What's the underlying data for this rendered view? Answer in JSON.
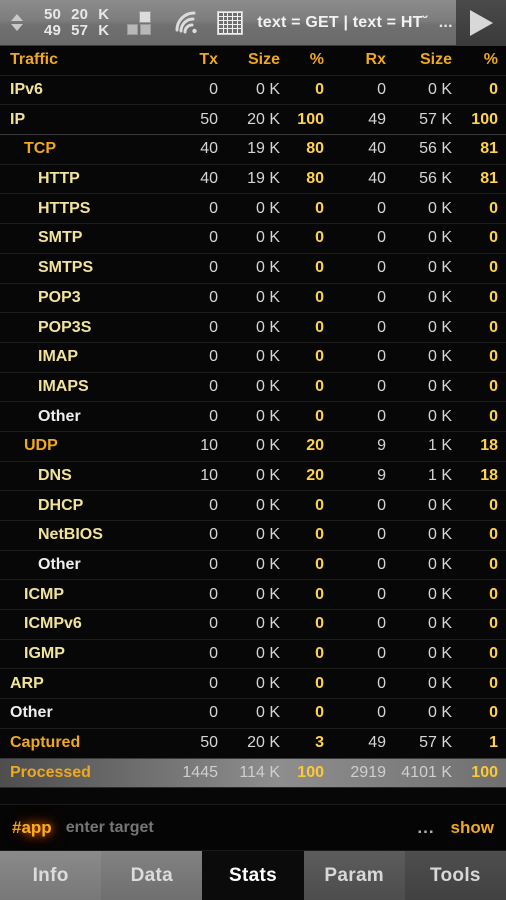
{
  "toolbar": {
    "counter_up": "50",
    "counter_down": "49",
    "size_up": "20",
    "size_down": "57",
    "unit_up": "K",
    "unit_down": "K",
    "icons": [
      "blocks-icon",
      "wifi-icon",
      "matrix-icon"
    ],
    "filter_text": "text = GET | text = HT˘",
    "filter_ellipsis": "...",
    "play_label": "play"
  },
  "table": {
    "columns": [
      "Traffic",
      "Tx",
      "Size",
      "%",
      "Rx",
      "Size",
      "%"
    ],
    "rows": [
      {
        "label": "IPv6",
        "indent": 0,
        "tone": "pale",
        "tx": "0",
        "tsize": "0 K",
        "tpct": "0",
        "rx": "0",
        "rsize": "0 K",
        "rpct": "0"
      },
      {
        "label": "IP",
        "indent": 0,
        "tone": "pale",
        "tx": "50",
        "tsize": "20 K",
        "tpct": "100",
        "rx": "49",
        "rsize": "57 K",
        "rpct": "100"
      },
      {
        "label": "TCP",
        "indent": 1,
        "tone": "amber",
        "tx": "40",
        "tsize": "19 K",
        "tpct": "80",
        "rx": "40",
        "rsize": "56 K",
        "rpct": "81"
      },
      {
        "label": "HTTP",
        "indent": 2,
        "tone": "pale",
        "tx": "40",
        "tsize": "19 K",
        "tpct": "80",
        "rx": "40",
        "rsize": "56 K",
        "rpct": "81"
      },
      {
        "label": "HTTPS",
        "indent": 2,
        "tone": "pale",
        "tx": "0",
        "tsize": "0 K",
        "tpct": "0",
        "rx": "0",
        "rsize": "0 K",
        "rpct": "0"
      },
      {
        "label": "SMTP",
        "indent": 2,
        "tone": "pale",
        "tx": "0",
        "tsize": "0 K",
        "tpct": "0",
        "rx": "0",
        "rsize": "0 K",
        "rpct": "0"
      },
      {
        "label": "SMTPS",
        "indent": 2,
        "tone": "pale",
        "tx": "0",
        "tsize": "0 K",
        "tpct": "0",
        "rx": "0",
        "rsize": "0 K",
        "rpct": "0"
      },
      {
        "label": "POP3",
        "indent": 2,
        "tone": "pale",
        "tx": "0",
        "tsize": "0 K",
        "tpct": "0",
        "rx": "0",
        "rsize": "0 K",
        "rpct": "0"
      },
      {
        "label": "POP3S",
        "indent": 2,
        "tone": "pale",
        "tx": "0",
        "tsize": "0 K",
        "tpct": "0",
        "rx": "0",
        "rsize": "0 K",
        "rpct": "0"
      },
      {
        "label": "IMAP",
        "indent": 2,
        "tone": "pale",
        "tx": "0",
        "tsize": "0 K",
        "tpct": "0",
        "rx": "0",
        "rsize": "0 K",
        "rpct": "0"
      },
      {
        "label": "IMAPS",
        "indent": 2,
        "tone": "pale",
        "tx": "0",
        "tsize": "0 K",
        "tpct": "0",
        "rx": "0",
        "rsize": "0 K",
        "rpct": "0"
      },
      {
        "label": "Other",
        "indent": 2,
        "tone": "white",
        "tx": "0",
        "tsize": "0 K",
        "tpct": "0",
        "rx": "0",
        "rsize": "0 K",
        "rpct": "0"
      },
      {
        "label": "UDP",
        "indent": 1,
        "tone": "amber",
        "tx": "10",
        "tsize": "0 K",
        "tpct": "20",
        "rx": "9",
        "rsize": "1 K",
        "rpct": "18"
      },
      {
        "label": "DNS",
        "indent": 2,
        "tone": "pale",
        "tx": "10",
        "tsize": "0 K",
        "tpct": "20",
        "rx": "9",
        "rsize": "1 K",
        "rpct": "18"
      },
      {
        "label": "DHCP",
        "indent": 2,
        "tone": "pale",
        "tx": "0",
        "tsize": "0 K",
        "tpct": "0",
        "rx": "0",
        "rsize": "0 K",
        "rpct": "0"
      },
      {
        "label": "NetBIOS",
        "indent": 2,
        "tone": "pale",
        "tx": "0",
        "tsize": "0 K",
        "tpct": "0",
        "rx": "0",
        "rsize": "0 K",
        "rpct": "0"
      },
      {
        "label": "Other",
        "indent": 2,
        "tone": "white",
        "tx": "0",
        "tsize": "0 K",
        "tpct": "0",
        "rx": "0",
        "rsize": "0 K",
        "rpct": "0"
      },
      {
        "label": "ICMP",
        "indent": 1,
        "tone": "pale",
        "tx": "0",
        "tsize": "0 K",
        "tpct": "0",
        "rx": "0",
        "rsize": "0 K",
        "rpct": "0"
      },
      {
        "label": "ICMPv6",
        "indent": 1,
        "tone": "pale",
        "tx": "0",
        "tsize": "0 K",
        "tpct": "0",
        "rx": "0",
        "rsize": "0 K",
        "rpct": "0"
      },
      {
        "label": "IGMP",
        "indent": 1,
        "tone": "pale",
        "tx": "0",
        "tsize": "0 K",
        "tpct": "0",
        "rx": "0",
        "rsize": "0 K",
        "rpct": "0"
      },
      {
        "label": "ARP",
        "indent": 0,
        "tone": "pale",
        "tx": "0",
        "tsize": "0 K",
        "tpct": "0",
        "rx": "0",
        "rsize": "0 K",
        "rpct": "0"
      },
      {
        "label": "Other",
        "indent": 0,
        "tone": "white",
        "tx": "0",
        "tsize": "0 K",
        "tpct": "0",
        "rx": "0",
        "rsize": "0 K",
        "rpct": "0"
      },
      {
        "label": "Captured",
        "indent": 0,
        "tone": "amber",
        "tx": "50",
        "tsize": "20 K",
        "tpct": "3",
        "rx": "49",
        "rsize": "57 K",
        "rpct": "1"
      },
      {
        "label": "Processed",
        "indent": 0,
        "tone": "amber",
        "tx": "1445",
        "tsize": "114 K",
        "tpct": "100",
        "rx": "2919",
        "rsize": "4101 K",
        "rpct": "100",
        "highlight": true
      }
    ]
  },
  "command_bar": {
    "prompt_hash": "#",
    "prompt_app": "app",
    "input_value": "",
    "input_placeholder": "enter target",
    "dots_label": "...",
    "show_label": "show"
  },
  "tabs": {
    "items": [
      {
        "label": "Info",
        "active": false
      },
      {
        "label": "Data",
        "active": false
      },
      {
        "label": "Stats",
        "active": true
      },
      {
        "label": "Param",
        "active": false
      },
      {
        "label": "Tools",
        "active": false
      }
    ]
  },
  "colors": {
    "amber": "#f0a81c",
    "pale_yellow": "#f2e39a",
    "value_gray": "#d5d5d5",
    "pct_gold": "#ffd24d",
    "background": "#070707"
  }
}
